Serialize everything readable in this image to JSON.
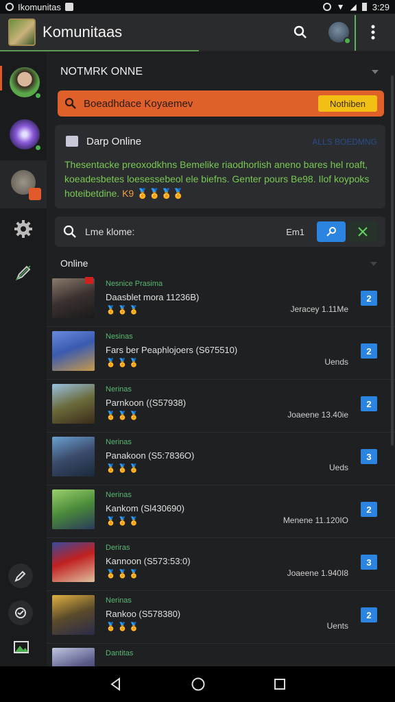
{
  "status_bar": {
    "app_label": "Ikomunitas",
    "time": "3:29"
  },
  "app_bar": {
    "title": "Komunitaas"
  },
  "section": {
    "title": "NOTMRK ONNE"
  },
  "search": {
    "placeholder": "Boeadhdace Koyaemev",
    "action_label": "Nothiben"
  },
  "info_card": {
    "title": "Darp Online",
    "tag": "ALLS BOEDMNG",
    "body": "Thesentacke preoxodkhns Bemelike riaodhorlish aneno bares hel roaft, koeadesbetes loesessebeol ele biefns. Genter pours Be98. Ilof koypoks hoteibetdine.",
    "emojis": "K9 🏅🏅🏅🏅"
  },
  "tool_row": {
    "label": "Lme klome:",
    "count": "Em1"
  },
  "online": {
    "title": "Online"
  },
  "list": [
    {
      "category": "Nesnice Prasima",
      "name": "Daasblet mora 11236B)",
      "emojis": "🏅🏅🏅",
      "meta": "Jeracey 1.11Me",
      "badge": "2"
    },
    {
      "category": "Nesinas",
      "name": "Fars ber Peaphlojoers (S675510)",
      "emojis": "🏅🏅🏅",
      "meta": "Uends",
      "badge": "2"
    },
    {
      "category": "Nerinas",
      "name": "Parnkoon ((S57938)",
      "emojis": "🏅🏅🏅",
      "meta": "Joaeene 13.40ie",
      "badge": "2"
    },
    {
      "category": "Nerinas",
      "name": "Panakoon (S5:7836O)",
      "emojis": "🏅🏅🏅",
      "meta": "Ueds",
      "badge": "3"
    },
    {
      "category": "Nerinas",
      "name": "Kankom (Sl430690)",
      "emojis": "🏅🏅🏅",
      "meta": "Menene 11.120IO",
      "badge": "2"
    },
    {
      "category": "Deriras",
      "name": "Kannoon (S573:53:0)",
      "emojis": "🏅🏅🏅",
      "meta": "Joaeene 1.940I8",
      "badge": "3"
    },
    {
      "category": "Nerinas",
      "name": "Rankoo (S578380)",
      "emojis": "🏅🏅🏅",
      "meta": "Uents",
      "badge": "2"
    },
    {
      "category": "Dantitas",
      "name": "",
      "emojis": "",
      "meta": "",
      "badge": ""
    }
  ]
}
